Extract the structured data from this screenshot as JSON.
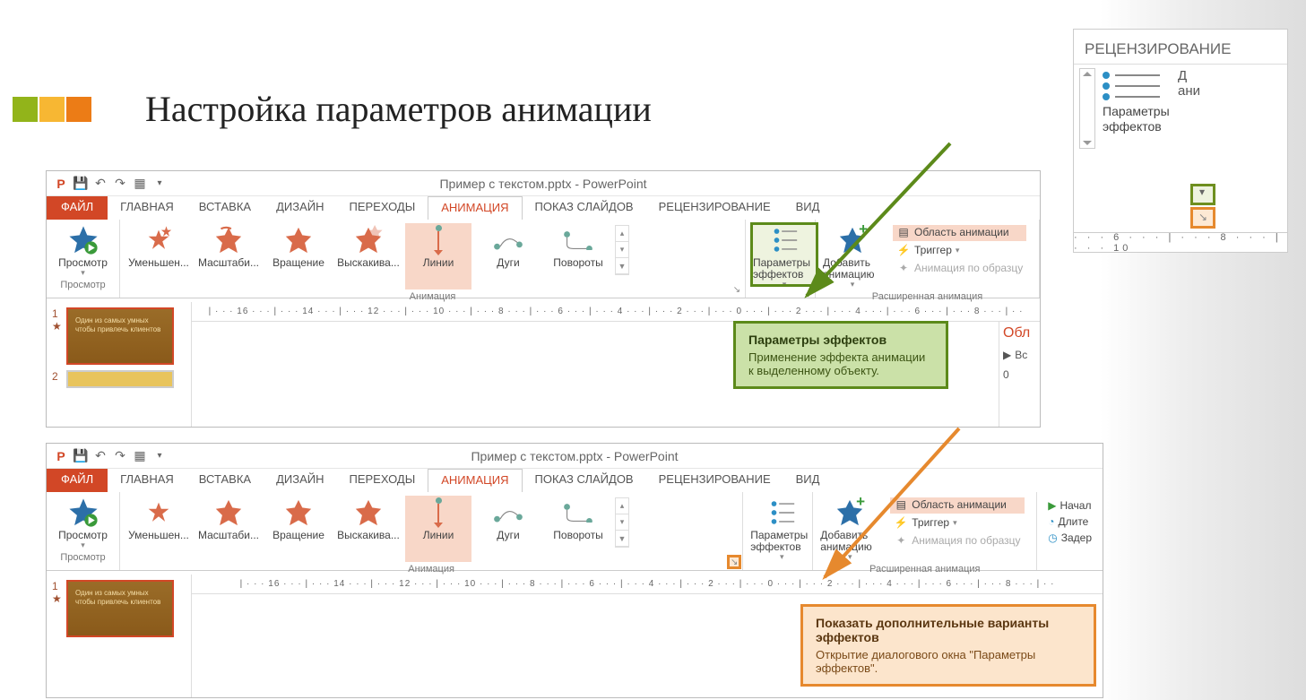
{
  "slide_title": "Настройка параметров анимации",
  "window_title": "Пример с текстом.pptx - PowerPoint",
  "tabs": {
    "file": "ФАЙЛ",
    "home": "ГЛАВНАЯ",
    "insert": "ВСТАВКА",
    "design": "ДИЗАЙН",
    "transitions": "ПЕРЕХОДЫ",
    "animation": "АНИМАЦИЯ",
    "slideshow": "ПОКАЗ СЛАЙДОВ",
    "review": "РЕЦЕНЗИРОВАНИЕ",
    "view": "ВИД"
  },
  "ribbon": {
    "preview": "Просмотр",
    "preview_group": "Просмотр",
    "anim_group": "Анимация",
    "adv_group": "Расширенная анимация",
    "gallery": {
      "shrink": "Уменьшен...",
      "scale": "Масштаби...",
      "rotate": "Вращение",
      "bounce": "Выскакива...",
      "lines": "Линии",
      "arcs": "Дуги",
      "turns": "Повороты"
    },
    "effect_options": "Параметры эффектов",
    "add_anim": "Добавить анимацию",
    "anim_pane": "Область анимации",
    "trigger": "Триггер",
    "anim_painter": "Анимация по образцу"
  },
  "timing": {
    "start": "Начал",
    "duration": "Длите",
    "delay": "Задер"
  },
  "tooltip_green": {
    "title": "Параметры эффектов",
    "body": "Применение эффекта анимации к выделенному объекту."
  },
  "tooltip_orange": {
    "title": "Показать дополнительные варианты эффектов",
    "body": "Открытие диалогового окна \"Параметры эффектов\"."
  },
  "inset": {
    "tab": "РЕЦЕНЗИРОВАНИЕ",
    "label": "Параметры эффектов",
    "right1": "Д",
    "right2": "ани",
    "ruler": "· · · 6 · · · | · · · 8 · · · | · · · 10"
  },
  "rightpane": {
    "header": "Обл",
    "play": "Вс",
    "zero": "0"
  },
  "thumb_text1": "Один из самых умных",
  "thumb_text2": "чтобы привлечь клиентов",
  "ruler_text": " | · · · 16 · · · | · · · 14 · · · | · · · 12 · · · | · · · 10 · · · | · · · 8 · · · | · · · 6 · · · | · · · 4 · · · | · · · 2 · · · | · · · 0 · · · | · · · 2 · · · | · · · 4 · · · | · · · 6 · · · | · · · 8 · · · | · · "
}
